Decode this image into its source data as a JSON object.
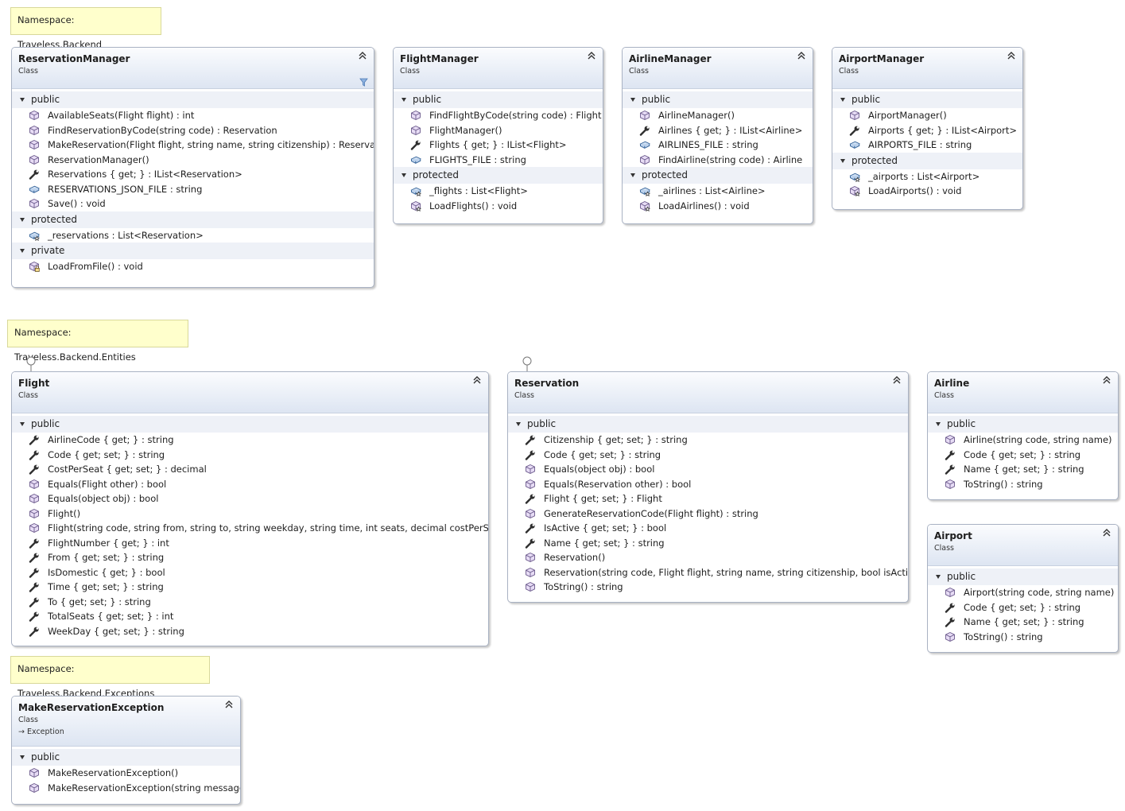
{
  "namespaces": [
    {
      "label": "Namespace: Traveless.Backend"
    },
    {
      "label": "Namespace: Traveless.Backend.Entities"
    },
    {
      "label": "Namespace: Traveless.Backend.Exceptions"
    }
  ],
  "classes": [
    {
      "name": "ReservationManager",
      "stereotype": "Class",
      "groups": [
        {
          "label": "public",
          "members": [
            {
              "icon": "method",
              "text": "AvailableSeats(Flight flight) : int"
            },
            {
              "icon": "method",
              "text": "FindReservationByCode(string code) : Reservation"
            },
            {
              "icon": "method",
              "text": "MakeReservation(Flight flight, string name, string citizenship) : Reservation"
            },
            {
              "icon": "method",
              "text": "ReservationManager()"
            },
            {
              "icon": "property",
              "text": "Reservations { get; } : IList<Reservation>"
            },
            {
              "icon": "field",
              "text": "RESERVATIONS_JSON_FILE : string"
            },
            {
              "icon": "method",
              "text": "Save() : void"
            }
          ]
        },
        {
          "label": "protected",
          "members": [
            {
              "icon": "protected-field",
              "text": "_reservations : List<Reservation>"
            }
          ]
        },
        {
          "label": "private",
          "members": [
            {
              "icon": "private-method",
              "text": "LoadFromFile() : void"
            }
          ]
        }
      ]
    },
    {
      "name": "FlightManager",
      "stereotype": "Class",
      "groups": [
        {
          "label": "public",
          "members": [
            {
              "icon": "method",
              "text": "FindFlightByCode(string code) : Flight"
            },
            {
              "icon": "method",
              "text": "FlightManager()"
            },
            {
              "icon": "property",
              "text": "Flights { get; } : IList<Flight>"
            },
            {
              "icon": "field",
              "text": "FLIGHTS_FILE : string"
            }
          ]
        },
        {
          "label": "protected",
          "members": [
            {
              "icon": "protected-field",
              "text": "_flights : List<Flight>"
            },
            {
              "icon": "protected-method",
              "text": "LoadFlights() : void"
            }
          ]
        }
      ]
    },
    {
      "name": "AirlineManager",
      "stereotype": "Class",
      "groups": [
        {
          "label": "public",
          "members": [
            {
              "icon": "method",
              "text": "AirlineManager()"
            },
            {
              "icon": "property",
              "text": "Airlines { get; } : IList<Airline>"
            },
            {
              "icon": "field",
              "text": "AIRLINES_FILE : string"
            },
            {
              "icon": "method",
              "text": "FindAirline(string code) : Airline"
            }
          ]
        },
        {
          "label": "protected",
          "members": [
            {
              "icon": "protected-field",
              "text": "_airlines : List<Airline>"
            },
            {
              "icon": "protected-method",
              "text": "LoadAirlines() : void"
            }
          ]
        }
      ]
    },
    {
      "name": "AirportManager",
      "stereotype": "Class",
      "groups": [
        {
          "label": "public",
          "members": [
            {
              "icon": "method",
              "text": "AirportManager()"
            },
            {
              "icon": "property",
              "text": "Airports { get; } : IList<Airport>"
            },
            {
              "icon": "field",
              "text": "AIRPORTS_FILE : string"
            }
          ]
        },
        {
          "label": "protected",
          "members": [
            {
              "icon": "protected-field",
              "text": "_airports : List<Airport>"
            },
            {
              "icon": "protected-method",
              "text": "LoadAirports() : void"
            }
          ]
        }
      ]
    },
    {
      "name": "Flight",
      "stereotype": "Class",
      "groups": [
        {
          "label": "public",
          "members": [
            {
              "icon": "property",
              "text": "AirlineCode { get; } : string"
            },
            {
              "icon": "property",
              "text": "Code { get; set; } : string"
            },
            {
              "icon": "property",
              "text": "CostPerSeat { get; set; } : decimal"
            },
            {
              "icon": "method",
              "text": "Equals(Flight other) : bool"
            },
            {
              "icon": "method",
              "text": "Equals(object obj) : bool"
            },
            {
              "icon": "method",
              "text": "Flight()"
            },
            {
              "icon": "method",
              "text": "Flight(string code, string from, string to, string weekday, string time, int seats, decimal costPerSeat)"
            },
            {
              "icon": "property",
              "text": "FlightNumber { get; } : int"
            },
            {
              "icon": "property",
              "text": "From { get; set; } : string"
            },
            {
              "icon": "property",
              "text": "IsDomestic { get; } : bool"
            },
            {
              "icon": "property",
              "text": "Time { get; set; } : string"
            },
            {
              "icon": "property",
              "text": "To { get; set; } : string"
            },
            {
              "icon": "property",
              "text": "TotalSeats { get; set; } : int"
            },
            {
              "icon": "property",
              "text": "WeekDay { get; set; } : string"
            }
          ]
        }
      ]
    },
    {
      "name": "Reservation",
      "stereotype": "Class",
      "groups": [
        {
          "label": "public",
          "members": [
            {
              "icon": "property",
              "text": "Citizenship { get; set; } : string"
            },
            {
              "icon": "property",
              "text": "Code { get; set; } : string"
            },
            {
              "icon": "method",
              "text": "Equals(object obj) : bool"
            },
            {
              "icon": "method",
              "text": "Equals(Reservation other) : bool"
            },
            {
              "icon": "property",
              "text": "Flight { get; set; } : Flight"
            },
            {
              "icon": "method",
              "text": "GenerateReservationCode(Flight flight) : string"
            },
            {
              "icon": "property",
              "text": "IsActive { get; set; } : bool"
            },
            {
              "icon": "property",
              "text": "Name { get; set; } : string"
            },
            {
              "icon": "method",
              "text": "Reservation()"
            },
            {
              "icon": "method",
              "text": "Reservation(string code, Flight flight, string name, string citizenship, bool isActive)"
            },
            {
              "icon": "method",
              "text": "ToString() : string"
            }
          ]
        }
      ]
    },
    {
      "name": "Airline",
      "stereotype": "Class",
      "groups": [
        {
          "label": "public",
          "members": [
            {
              "icon": "method",
              "text": "Airline(string code, string name)"
            },
            {
              "icon": "property",
              "text": "Code { get; set; } : string"
            },
            {
              "icon": "property",
              "text": "Name { get; set; } : string"
            },
            {
              "icon": "method",
              "text": "ToString() : string"
            }
          ]
        }
      ]
    },
    {
      "name": "Airport",
      "stereotype": "Class",
      "groups": [
        {
          "label": "public",
          "members": [
            {
              "icon": "method",
              "text": "Airport(string code, string name)"
            },
            {
              "icon": "property",
              "text": "Code { get; set; } : string"
            },
            {
              "icon": "property",
              "text": "Name { get; set; } : string"
            },
            {
              "icon": "method",
              "text": "ToString() : string"
            }
          ]
        }
      ]
    },
    {
      "name": "MakeReservationException",
      "stereotype": "Class",
      "base": "Exception",
      "groups": [
        {
          "label": "public",
          "members": [
            {
              "icon": "method",
              "text": "MakeReservationException()"
            },
            {
              "icon": "method",
              "text": "MakeReservationException(string message)"
            }
          ]
        }
      ]
    }
  ]
}
